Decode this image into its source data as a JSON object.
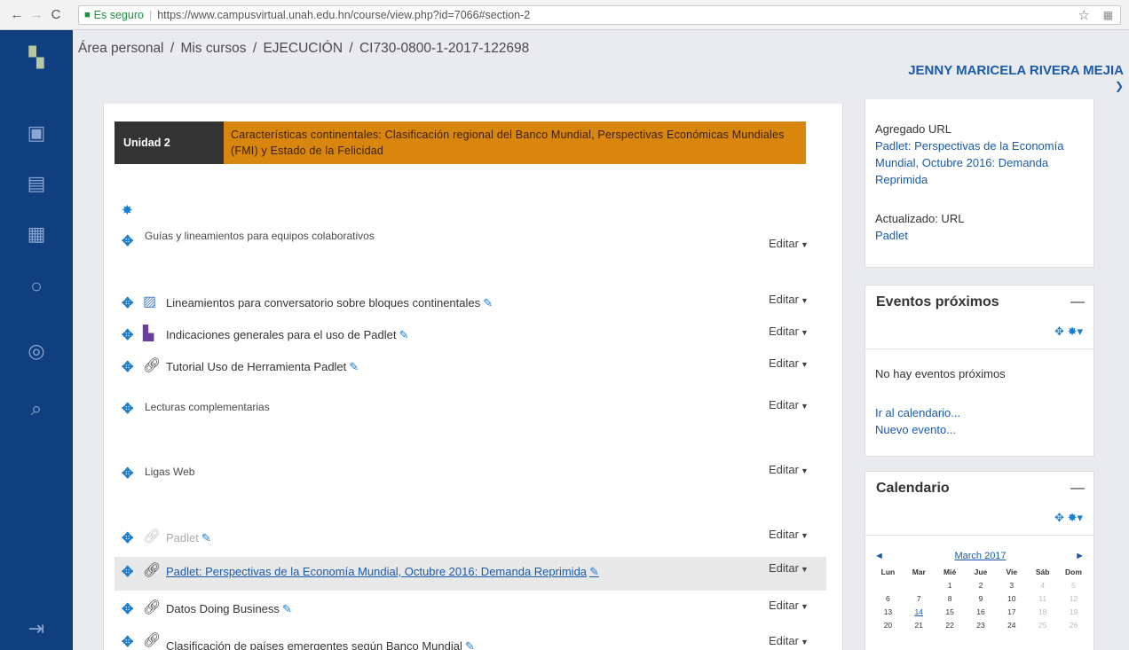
{
  "browser": {
    "secure_label": "Es seguro",
    "url": "https://www.campusvirtual.unah.edu.hn/course/view.php?id=7066#section-2"
  },
  "breadcrumb": [
    "Área personal",
    "Mis cursos",
    "EJECUCIÓN",
    "CI730-0800-1-2017-122698"
  ],
  "user": {
    "name": "JENNY MARICELA RIVERA MEJIA"
  },
  "section": {
    "unit_label": "Unidad 2",
    "unit_title": "Características continentales: Clasificación regional del Banco Mundial, Perspectivas Económicas Mundiales (FMI) y Estado de la Felicidad"
  },
  "edit_label": "Editar",
  "rows": [
    {
      "text": "Guías y lineamientos para equipos colaborativos",
      "kind": "label"
    },
    {
      "text": "Lineamientos para conversatorio sobre bloques continentales",
      "kind": "activity"
    },
    {
      "text": "Indicaciones generales para el uso de Padlet",
      "kind": "activity"
    },
    {
      "text": "Tutorial Uso de Herramienta Padlet",
      "kind": "activity"
    },
    {
      "text": "Lecturas complementarias",
      "kind": "label"
    },
    {
      "text": "Ligas Web",
      "kind": "label"
    },
    {
      "text": "Padlet",
      "kind": "hidden"
    },
    {
      "text": "Padlet: Perspectivas de la Economía Mundial, Octubre 2016: Demanda Reprimida",
      "kind": "link"
    },
    {
      "text": "Datos Doing Business",
      "kind": "activity"
    },
    {
      "text": "Clasificación de países emergentes según Banco Mundial",
      "kind": "activity"
    }
  ],
  "recent": {
    "added_label": "Agregado URL",
    "added_link": "Padlet: Perspectivas de la Economía Mundial, Octubre 2016: Demanda Reprimida",
    "updated_label": "Actualizado: URL",
    "updated_link": "Padlet"
  },
  "events": {
    "title": "Eventos próximos",
    "empty": "No hay eventos próximos",
    "goto_calendar": "Ir al calendario...",
    "new_event": "Nuevo evento..."
  },
  "calendar": {
    "title": "Calendario",
    "month": "March 2017",
    "weekdays": [
      "Lun",
      "Mar",
      "Mié",
      "Jue",
      "Vie",
      "Sáb",
      "Dom"
    ],
    "weeks": [
      [
        "",
        "",
        "1",
        "2",
        "3",
        "4",
        "5"
      ],
      [
        "6",
        "7",
        "8",
        "9",
        "10",
        "11",
        "12"
      ],
      [
        "13",
        "14",
        "15",
        "16",
        "17",
        "18",
        "19"
      ],
      [
        "20",
        "21",
        "22",
        "23",
        "24",
        "25",
        "26"
      ]
    ],
    "today": "14"
  }
}
